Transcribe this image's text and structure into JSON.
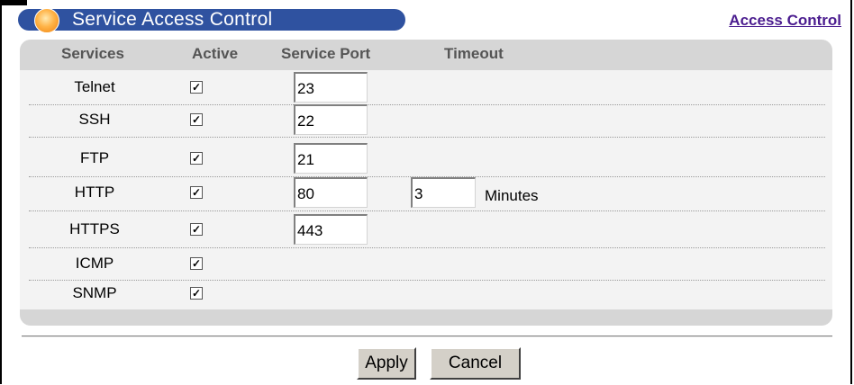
{
  "title": "Service Access Control",
  "header_link": "Access Control",
  "columns": {
    "services": "Services",
    "active": "Active",
    "port": "Service Port",
    "timeout": "Timeout"
  },
  "rows": [
    {
      "service": "Telnet",
      "active": true,
      "port": "23"
    },
    {
      "service": "SSH",
      "active": true,
      "port": "22"
    },
    {
      "service": "FTP",
      "active": true,
      "port": "21"
    },
    {
      "service": "HTTP",
      "active": true,
      "port": "80",
      "timeout": "3",
      "timeout_unit": "Minutes"
    },
    {
      "service": "HTTPS",
      "active": true,
      "port": "443"
    },
    {
      "service": "ICMP",
      "active": true
    },
    {
      "service": "SNMP",
      "active": true
    }
  ],
  "buttons": {
    "apply": "Apply",
    "cancel": "Cancel"
  },
  "colors": {
    "title_bar": "#2f52a0",
    "link": "#4b1d8f",
    "panel": "#f3f3f3",
    "band": "#d6d6d6"
  }
}
